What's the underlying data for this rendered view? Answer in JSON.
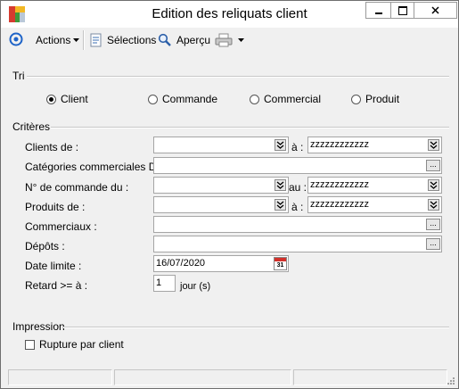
{
  "window": {
    "title": "Edition des reliquats client"
  },
  "toolbar": {
    "actions_label": "Actions",
    "selections_label": "Sélections",
    "apercu_label": "Aperçu"
  },
  "tri": {
    "label": "Tri",
    "options": [
      "Client",
      "Commande",
      "Commercial",
      "Produit"
    ],
    "selected": "Client"
  },
  "criteres": {
    "label": "Critères",
    "clients": {
      "label": "Clients de :",
      "to_label": "à :",
      "from": "",
      "to": "zzzzzzzzzzzz"
    },
    "categories": {
      "label": "Catégories commerciales DO :",
      "value": ""
    },
    "commande": {
      "label": "N° de commande du :",
      "to_label": "au :",
      "from": "",
      "to": "zzzzzzzzzzzz"
    },
    "produits": {
      "label": "Produits de :",
      "to_label": "à :",
      "from": "",
      "to": "zzzzzzzzzzzz"
    },
    "commerciaux": {
      "label": "Commerciaux :",
      "value": ""
    },
    "depots": {
      "label": "Dépôts :",
      "value": ""
    },
    "date_limite": {
      "label": "Date limite :",
      "value": "16/07/2020",
      "calendar_day": "31"
    },
    "retard": {
      "label": "Retard >= à :",
      "value": "1",
      "unit": "jour (s)"
    }
  },
  "impression": {
    "label": "Impression",
    "rupture": {
      "label": "Rupture par client",
      "checked": false
    }
  },
  "colors": {
    "accent": "#1f64c8",
    "window_bg": "#f0f0f0"
  },
  "icons": [
    "app-icon",
    "minimize-icon",
    "maximize-icon",
    "close-icon",
    "target-icon",
    "selections-icon",
    "search-icon",
    "printer-icon",
    "chevron-down-icon",
    "calendar-icon",
    "resize-grip-icon"
  ]
}
